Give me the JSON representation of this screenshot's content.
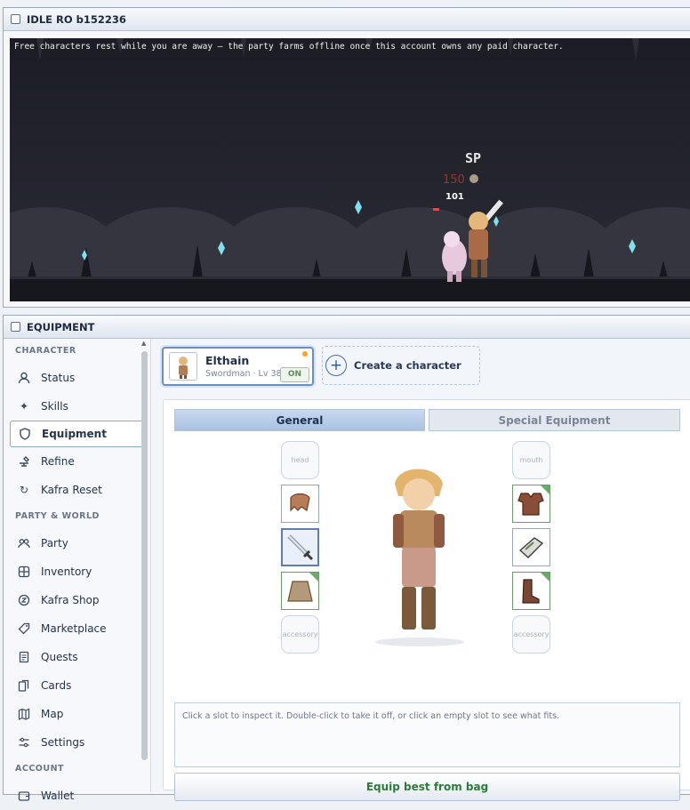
{
  "game_window": {
    "title": "IDLE RO b152236",
    "notice": "Free characters rest while you are away — the party farms offline once this account owns any paid character.",
    "damage_text": "150",
    "hp_value": "101"
  },
  "equipment_window": {
    "title": "EQUIPMENT"
  },
  "sidebar": {
    "sections": {
      "character": "CHARACTER",
      "party_world": "PARTY & WORLD",
      "account": "ACCOUNT"
    },
    "items": [
      {
        "label": "Status",
        "icon": "user-icon"
      },
      {
        "label": "Skills",
        "icon": "sparkle-icon"
      },
      {
        "label": "Equipment",
        "icon": "shield-icon"
      },
      {
        "label": "Refine",
        "icon": "anvil-icon"
      },
      {
        "label": "Kafra Reset",
        "icon": "reset-icon"
      },
      {
        "label": "Party",
        "icon": "party-icon"
      },
      {
        "label": "Inventory",
        "icon": "grid-icon"
      },
      {
        "label": "Kafra Shop",
        "icon": "coin-icon"
      },
      {
        "label": "Marketplace",
        "icon": "tag-icon"
      },
      {
        "label": "Quests",
        "icon": "scroll-icon"
      },
      {
        "label": "Cards",
        "icon": "cards-icon"
      },
      {
        "label": "Map",
        "icon": "map-icon"
      },
      {
        "label": "Settings",
        "icon": "sliders-icon"
      },
      {
        "label": "Wallet",
        "icon": "wallet-icon"
      }
    ]
  },
  "character": {
    "name": "Elthain",
    "subtitle": "Swordman · Lv 38",
    "status_badge": "ON"
  },
  "create_character_label": "Create a character",
  "tabs": {
    "general": "General",
    "special": "Special Equipment"
  },
  "slots": {
    "head": "head",
    "mouth": "mouth",
    "accessory_left": "accessory",
    "accessory_right": "accessory"
  },
  "info_text": "Click a slot to inspect it. Double-click to take it off, or click an empty slot to see what fits.",
  "equip_best_label": "Equip best from bag"
}
